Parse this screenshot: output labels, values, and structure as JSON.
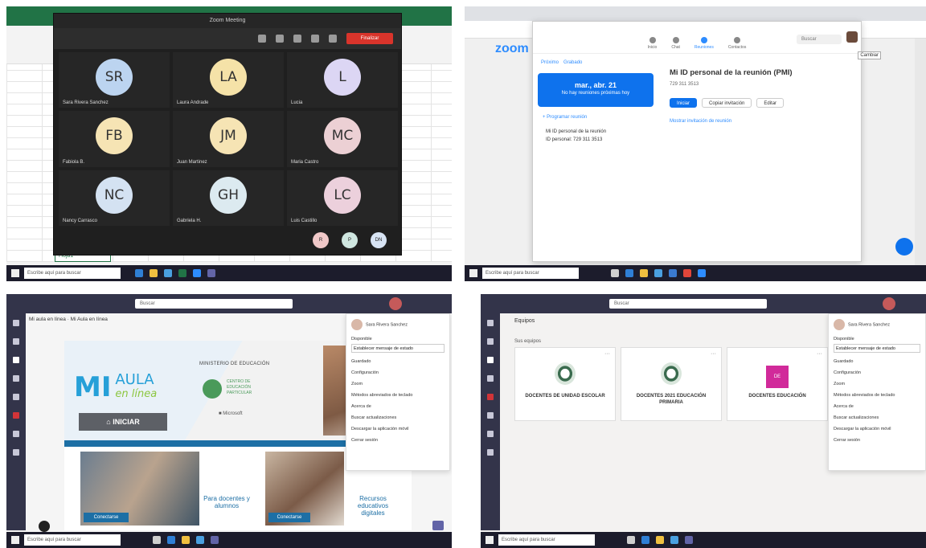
{
  "q1": {
    "zoom_title": "Zoom Meeting",
    "end_label": "Finalizar",
    "participants": [
      {
        "initials": "SR",
        "name": "Sara Rivera Sanchez",
        "color": "#bcd4f0"
      },
      {
        "initials": "LA",
        "name": "Laura Andrade",
        "color": "#f5e2a8"
      },
      {
        "initials": "L",
        "name": "Lucia",
        "color": "#dcd6f4"
      },
      {
        "initials": "FB",
        "name": "Fabiola B.",
        "color": "#f6e4b4"
      },
      {
        "initials": "JM",
        "name": "Juan Martinez",
        "color": "#f6e4b4"
      },
      {
        "initials": "MC",
        "name": "Maria Castro",
        "color": "#ecd0d4"
      },
      {
        "initials": "NC",
        "name": "Nancy Carrasco",
        "color": "#d4e2f2"
      },
      {
        "initials": "GH",
        "name": "Gabriela H.",
        "color": "#dceaf0"
      },
      {
        "initials": "LC",
        "name": "Luis Castillo",
        "color": "#ecd0dc"
      }
    ],
    "mini": [
      {
        "initials": "R",
        "color": "#f0c8c8"
      },
      {
        "initials": "P",
        "color": "#cfe6e0"
      },
      {
        "initials": "DN",
        "color": "#d8e4f4"
      }
    ],
    "taskbar_search": "Escribe aquí para buscar"
  },
  "q2": {
    "zoom_logo": "zoom",
    "nav": [
      {
        "label": "Inicio"
      },
      {
        "label": "Chat"
      },
      {
        "label": "Reuniones",
        "active": true
      },
      {
        "label": "Contactos"
      }
    ],
    "search_placeholder": "Buscar",
    "badge": "Cambiar",
    "date_buttons": [
      "Próximo",
      "Grabado"
    ],
    "date_card_line1": "mar., abr. 21",
    "date_card_line2": "No hay reuniones próximas hoy",
    "left_link": "+ Programar reunión",
    "left_text1": "Mi ID personal de la reunión",
    "left_text2": "ID personal: 729 311 3513",
    "meeting_title": "Mi ID personal de la reunión (PMI)",
    "meeting_id": "729 311 3513",
    "btn_start": "Iniciar",
    "btn_copy": "Copiar invitación",
    "btn_edit": "Editar",
    "show_invite": "Mostrar invitación de reunión",
    "taskbar_search": "Escribe aquí para buscar"
  },
  "q3": {
    "search": "Buscar",
    "header": "Mi aula en línea · Mi Aula en línea",
    "aula_mi": "MI",
    "aula_word1": "AULA",
    "aula_word2": "en línea",
    "aula_btn": "INICIAR",
    "ministry": "MINISTERIO DE EDUCACIÓN",
    "cep": "CENTRO DE EDUCACIÓN PARTICULAR",
    "microsoft": "Microsoft",
    "card1_tag": "Conectarse",
    "card1_text": "Para docentes y alumnos",
    "card2_tag": "Conectarse",
    "card2_text": "Recursos educativos digitales",
    "panel": {
      "name": "Sara Rivera Sanchez",
      "status_label": "Disponible",
      "status_msg": "Establecer mensaje de estado",
      "saved": "Guardado",
      "settings": "Configuración",
      "zoom": "Zoom",
      "shortcuts": "Métodos abreviados de teclado",
      "about": "Acerca de",
      "updates": "Buscar actualizaciones",
      "mobile": "Descargar la aplicación móvil",
      "signout": "Cerrar sesión"
    },
    "taskbar_search": "Escribe aquí para buscar"
  },
  "q4": {
    "search": "Buscar",
    "title": "Equipos",
    "sub": "Sus equipos",
    "teams": [
      {
        "name": "DOCENTES DE UNIDAD ESCOLAR",
        "kind": "emblem"
      },
      {
        "name": "DOCENTES 2021 EDUCACIÓN PRIMARIA",
        "kind": "emblem"
      },
      {
        "name": "DOCENTES EDUCACIÓN",
        "kind": "square",
        "sq": "DE"
      }
    ],
    "panel": {
      "name": "Sara Rivera Sanchez",
      "status_label": "Disponible",
      "status_msg": "Establecer mensaje de estado",
      "saved": "Guardado",
      "settings": "Configuración",
      "zoom": "Zoom",
      "shortcuts": "Métodos abreviados de teclado",
      "about": "Acerca de",
      "updates": "Buscar actualizaciones",
      "mobile": "Descargar la aplicación móvil",
      "signout": "Cerrar sesión"
    },
    "taskbar_search": "Escribe aquí para buscar"
  }
}
